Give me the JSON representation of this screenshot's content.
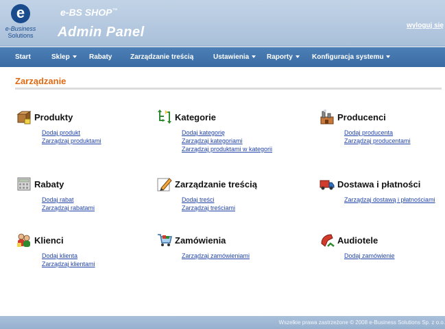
{
  "header": {
    "logo_letter": "e",
    "logo_line1": "e-Business",
    "logo_line2": "Solutions",
    "shop_title": "e-BS SHOP",
    "shop_tm": "™",
    "panel_title": "Admin Panel",
    "logout": "wyloguj się"
  },
  "nav": {
    "items": [
      {
        "label": "Start",
        "dropdown": false
      },
      {
        "label": "Sklep",
        "dropdown": true
      },
      {
        "label": "Rabaty",
        "dropdown": false
      },
      {
        "label": "Zarządzanie treścią",
        "dropdown": false
      },
      {
        "label": "Ustawienia",
        "dropdown": true
      },
      {
        "label": "Raporty",
        "dropdown": true
      },
      {
        "label": "Konfiguracja systemu",
        "dropdown": true
      }
    ]
  },
  "page": {
    "title": "Zarządzanie"
  },
  "sections": [
    {
      "title": "Produkty",
      "icon": "boxes-icon",
      "links": [
        "Dodaj produkt",
        "Zarządzaj produktami"
      ]
    },
    {
      "title": "Kategorie",
      "icon": "tree-icon",
      "links": [
        "Dodaj kategorię",
        "Zarządzaj kategoriami",
        "Zarządzaj produktami w kategorii"
      ]
    },
    {
      "title": "Producenci",
      "icon": "factory-icon",
      "links": [
        "Dodaj producenta",
        "Zarządzaj producentami"
      ]
    },
    {
      "title": "Rabaty",
      "icon": "calculator-icon",
      "links": [
        "Dodaj rabat",
        "Zarządzaj rabatami"
      ]
    },
    {
      "title": "Zarządzanie treścią",
      "icon": "pencil-icon",
      "links": [
        "Dodaj treści",
        "Zarządzaj treściami"
      ]
    },
    {
      "title": "Dostawa i płatności",
      "icon": "truck-icon",
      "links": [
        "Zarządzaj dostawą i płatnościami"
      ]
    },
    {
      "title": "Klienci",
      "icon": "users-icon",
      "links": [
        "Dodaj klienta",
        "Zarządzaj klientami"
      ]
    },
    {
      "title": "Zamówienia",
      "icon": "cart-icon",
      "links": [
        "Zarządzaj zamówieniami"
      ]
    },
    {
      "title": "Audiotele",
      "icon": "phone-icon",
      "links": [
        "Dodaj zamówienie"
      ]
    }
  ],
  "footer": {
    "text": "Wszelkie prawa zastrzeżone © 2008 e-Business Solutions Sp. z o.o."
  },
  "colors": {
    "header_bg": "#b3c8df",
    "nav_bg": "#4475ac",
    "title_orange": "#e06a12",
    "link_blue": "#2244aa"
  }
}
